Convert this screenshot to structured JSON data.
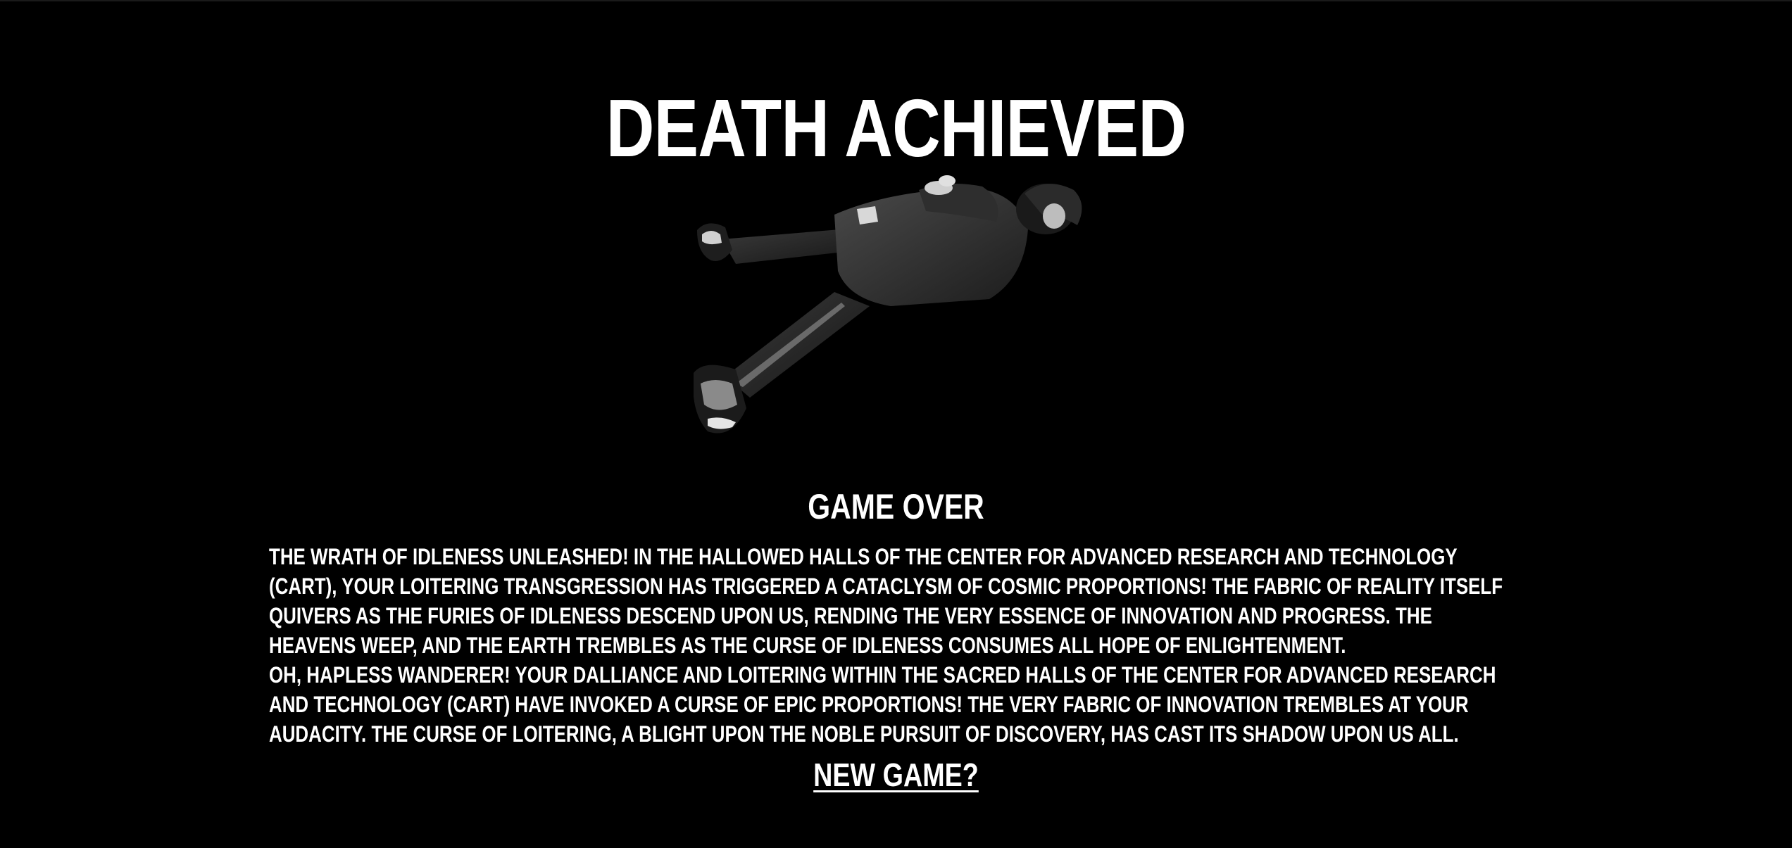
{
  "game": {
    "title": "DEATH ACHIEVED",
    "status": "GAME OVER",
    "paragraphs": [
      "THE WRATH OF IDLENESS UNLEASHED! IN THE HALLOWED HALLS OF THE CENTER FOR ADVANCED RESEARCH AND TECHNOLOGY (CART), YOUR LOITERING TRANSGRESSION HAS TRIGGERED A CATACLYSM OF COSMIC PROPORTIONS! THE FABRIC OF REALITY ITSELF QUIVERS AS THE FURIES OF IDLENESS DESCEND UPON US, RENDING THE VERY ESSENCE OF INNOVATION AND PROGRESS. THE HEAVENS WEEP, AND THE EARTH TREMBLES AS THE CURSE OF IDLENESS CONSUMES ALL HOPE OF ENLIGHTENMENT.",
      "OH, HAPLESS WANDERER! YOUR DALLIANCE AND LOITERING WITHIN THE SACRED HALLS OF THE CENTER FOR ADVANCED RESEARCH AND TECHNOLOGY (CART) HAVE INVOKED A CURSE OF EPIC PROPORTIONS! THE VERY FABRIC OF INNOVATION TREMBLES AT YOUR AUDACITY. THE CURSE OF LOITERING, A BLIGHT UPON THE NOBLE PURSUIT OF DISCOVERY, HAS CAST ITS SHADOW UPON US ALL."
    ],
    "new_game_label": "NEW GAME?"
  },
  "colors": {
    "background": "#000000",
    "text": "#ffffff"
  },
  "icons": {
    "figure": "fallen-person-icon"
  }
}
